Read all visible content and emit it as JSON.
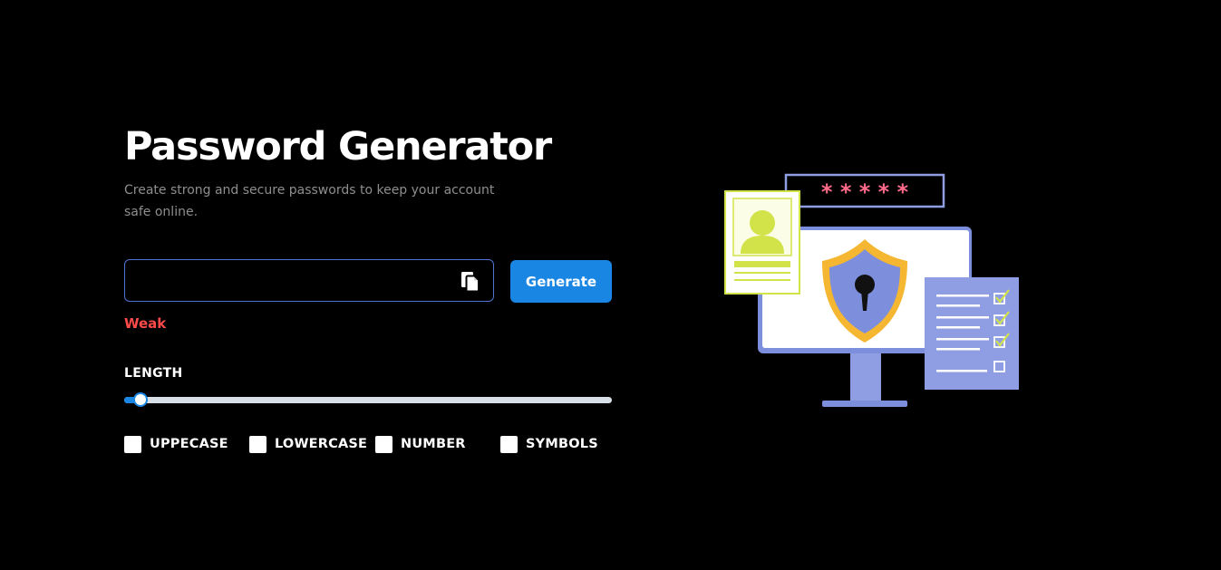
{
  "header": {
    "title": "Password Generator",
    "subtitle": "Create strong and secure passwords to keep your account safe online."
  },
  "password": {
    "value": "",
    "placeholder": "",
    "copy_icon": "copy-icon"
  },
  "generate_button": {
    "label": "Generate"
  },
  "strength": {
    "label": "Weak",
    "color": "#ff4a4a"
  },
  "length": {
    "label": "LENGTH",
    "fraction": 0.02
  },
  "options": [
    {
      "label": "UPPECASE",
      "checked": false
    },
    {
      "label": "LOWERCASE",
      "checked": false
    },
    {
      "label": "NUMBER",
      "checked": false
    },
    {
      "label": "SYMBOLS",
      "checked": false
    }
  ],
  "illustration": {
    "masked_password": "* * * * *",
    "icon": "security-shield-illustration"
  },
  "colors": {
    "accent": "#1a86e3",
    "background": "#000000",
    "border": "#4f74d1",
    "weak": "#ff4a4a"
  }
}
